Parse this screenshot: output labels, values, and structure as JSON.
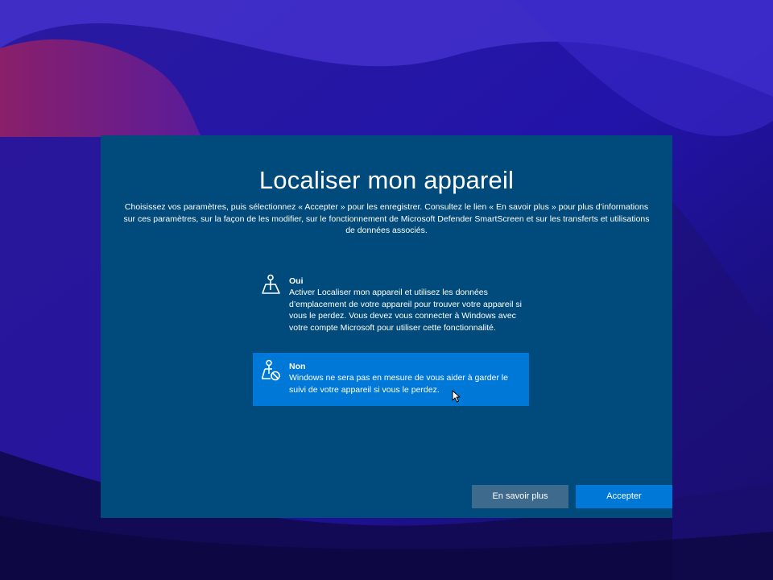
{
  "window": {
    "title": "Localiser mon appareil",
    "description": "Choisissez vos paramètres, puis sélectionnez « Accepter » pour les enregistrer. Consultez le lien « En savoir plus » pour plus d’informations sur ces paramètres, sur la façon de les modifier, sur le fonctionnement de Microsoft Defender SmartScreen et sur les transferts et utilisations de données associés."
  },
  "options": [
    {
      "label": "Oui",
      "description": "Activer Localiser mon appareil et utilisez les données d’emplacement de votre appareil pour trouver votre appareil si vous le perdez. Vous devez vous connecter à Windows avec votre compte Microsoft pour utiliser cette fonctionnalité.",
      "icon": "map-pin-icon",
      "selected": false
    },
    {
      "label": "Non",
      "description": "Windows ne sera pas en mesure de vous aider à garder le suivi de votre appareil si vous le perdez.",
      "icon": "map-pin-blocked-icon",
      "selected": true
    }
  ],
  "buttons": {
    "learn_more": "En savoir plus",
    "accept": "Accepter"
  },
  "colors": {
    "window_background": "#004b7b",
    "selected_option": "#0078d7",
    "accept_button": "#0078d7",
    "secondary_button": "#3e6a8d"
  }
}
